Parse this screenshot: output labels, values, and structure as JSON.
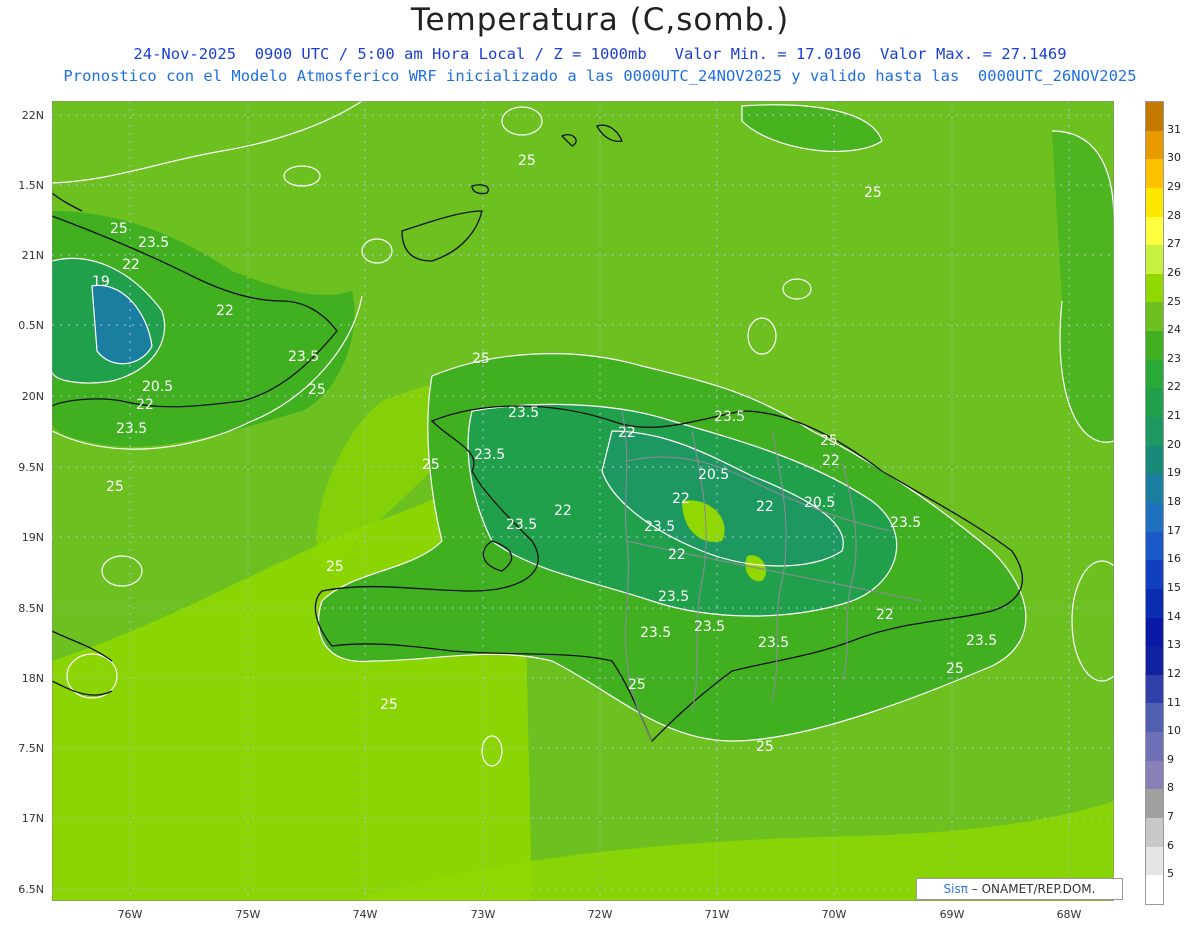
{
  "title": "Temperatura (C,somb.)",
  "subtitle1": "24-Nov-2025  0900 UTC / 5:00 am Hora Local / Z = 1000mb   Valor Min. = 17.0106  Valor Max. = 27.1469",
  "subtitle2": "Pronostico con el Modelo Atmosferico WRF inicializado a las 0000UTC_24NOV2025 y valido hasta las  0000UTC_26NOV2025",
  "lat_labels": [
    "22N",
    "1.5N",
    "21N",
    "0.5N",
    "20N",
    "9.5N",
    "19N",
    "8.5N",
    "18N",
    "7.5N",
    "17N",
    "6.5N"
  ],
  "lon_labels": [
    "76W",
    "75W",
    "74W",
    "73W",
    "72W",
    "71W",
    "70W",
    "69W",
    "68W"
  ],
  "colorbar": {
    "labels": [
      "31",
      "30",
      "29",
      "28",
      "27",
      "26",
      "25",
      "24",
      "23",
      "22",
      "21",
      "20",
      "19",
      "18",
      "17",
      "16",
      "15",
      "14",
      "13",
      "12",
      "11",
      "10",
      "9",
      "8",
      "7",
      "6",
      "5"
    ],
    "colors": [
      "#c47a00",
      "#e89a00",
      "#ffc000",
      "#ffe800",
      "#ffff40",
      "#c8f040",
      "#90d800",
      "#6cc020",
      "#40b020",
      "#2aa838",
      "#20a04a",
      "#1c9860",
      "#188a7a",
      "#1a7ea0",
      "#2070c0",
      "#1a58c8",
      "#1040c0",
      "#0a2cb0",
      "#0a18a8",
      "#1020a0",
      "#3040a8",
      "#5060b0",
      "#7070b8",
      "#8a80b8",
      "#a0a0a0",
      "#c8c8c8",
      "#e6e6e6",
      "#ffffff"
    ]
  },
  "contour_labels": [
    "25",
    "23.5",
    "22",
    "20.5",
    "19"
  ],
  "credit": {
    "brand": "Sisπ",
    "text": "– ONAMET/REP.DOM."
  },
  "colors": {
    "sea": "#6cc020",
    "warm_band": "#90d800",
    "land": "#40b020",
    "cool_land": "#20a04a",
    "coast": "#111111",
    "contour": "#ffffff",
    "grid": "#b5c0e0"
  }
}
